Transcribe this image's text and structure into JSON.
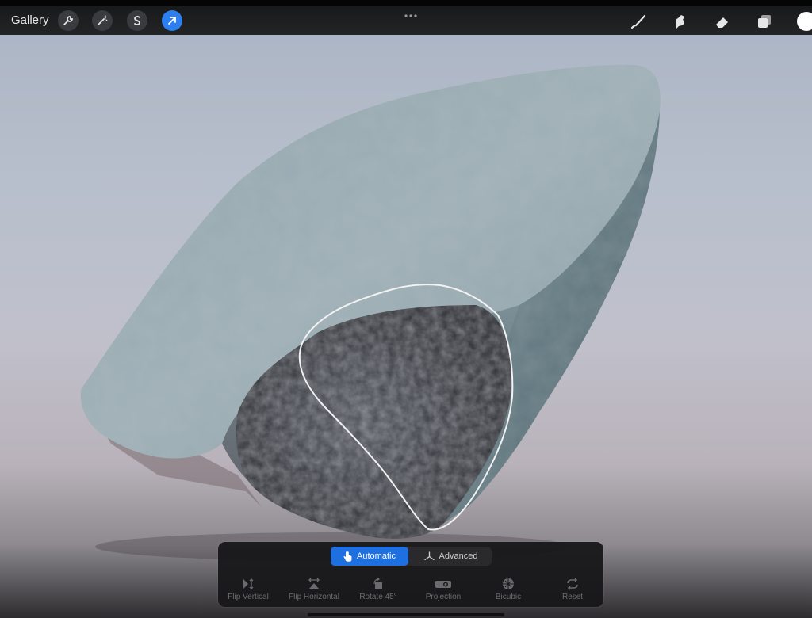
{
  "topbar": {
    "gallery_label": "Gallery",
    "left_tools": [
      "wrench-icon",
      "magic-wand-icon",
      "selection-s-icon",
      "transform-arrow-icon"
    ],
    "right_tools": [
      "brush-icon",
      "smudge-icon",
      "eraser-icon",
      "layers-icon"
    ],
    "active_tool": "transform-arrow-icon",
    "current_color": "#ffffff",
    "accent_color": "#2d7ff0"
  },
  "transform_panel": {
    "modes": {
      "automatic_label": "Automatic",
      "advanced_label": "Advanced",
      "selected": "Automatic"
    },
    "options": [
      {
        "label": "Flip Vertical",
        "icon": "flip-vertical-icon"
      },
      {
        "label": "Flip Horizontal",
        "icon": "flip-horizontal-icon"
      },
      {
        "label": "Rotate 45°",
        "icon": "rotate-icon"
      },
      {
        "label": "Projection",
        "icon": "projection-icon"
      },
      {
        "label": "Bicubic",
        "icon": "bicubic-icon"
      },
      {
        "label": "Reset",
        "icon": "reset-icon"
      }
    ]
  }
}
